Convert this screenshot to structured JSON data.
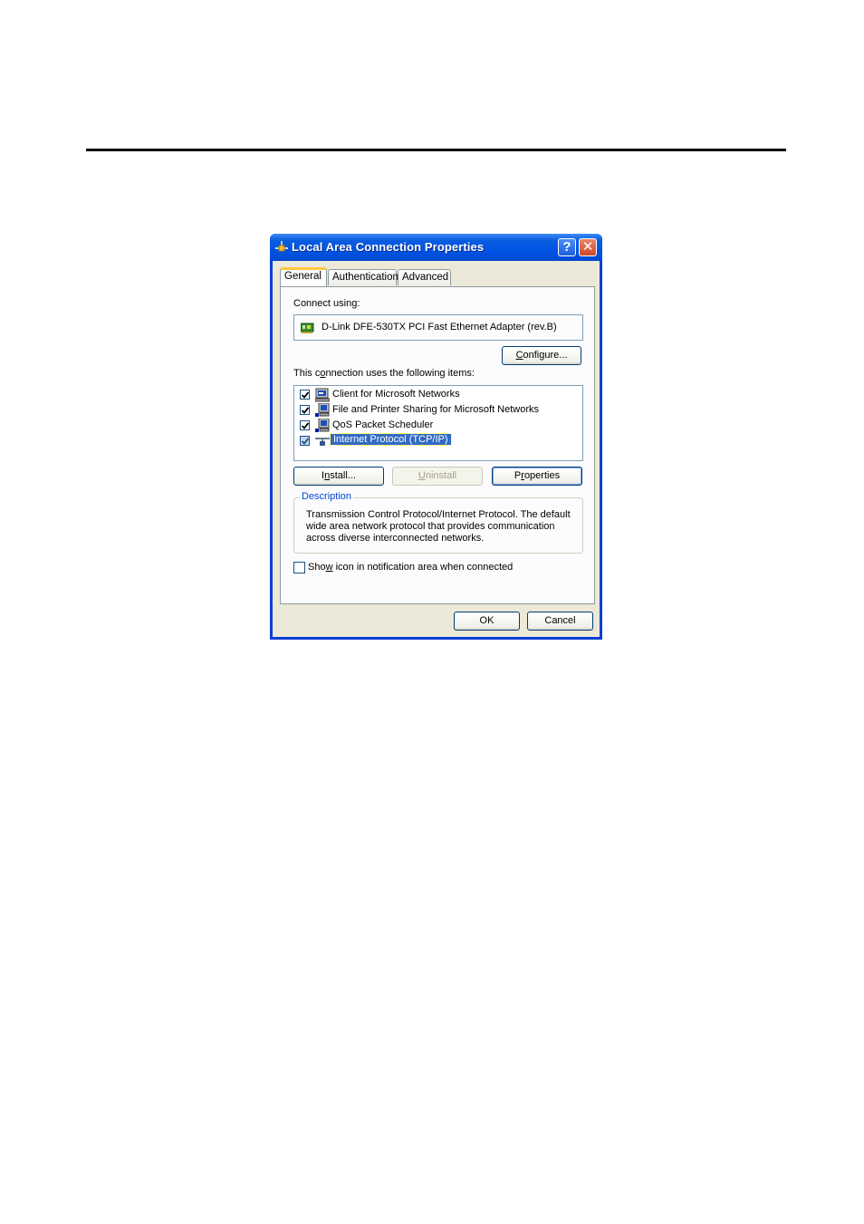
{
  "dialog": {
    "title": "Local Area Connection Properties",
    "help_button": "?",
    "close_button": "✕",
    "tabs": [
      {
        "label": "General",
        "active": true
      },
      {
        "label": "Authentication",
        "active": false
      },
      {
        "label": "Advanced",
        "active": false
      }
    ],
    "connect_using_label": "Connect using:",
    "adapter_name": "D-Link DFE-530TX PCI Fast Ethernet Adapter (rev.B)",
    "configure_button": {
      "pre": "",
      "mnemonic": "C",
      "post": "onfigure..."
    },
    "items_label": {
      "pre": "This c",
      "mnemonic": "o",
      "post": "nnection uses the following items:"
    },
    "items": [
      {
        "label": "Client for Microsoft Networks",
        "checked": true,
        "selected": false,
        "icon": "network-client-icon"
      },
      {
        "label": "File and Printer Sharing for Microsoft Networks",
        "checked": true,
        "selected": false,
        "icon": "network-service-icon"
      },
      {
        "label": "QoS Packet Scheduler",
        "checked": true,
        "selected": false,
        "icon": "network-service-icon"
      },
      {
        "label": "Internet Protocol (TCP/IP)",
        "checked": true,
        "selected": true,
        "icon": "network-protocol-icon"
      }
    ],
    "install_button": {
      "pre": "I",
      "mnemonic": "n",
      "post": "stall..."
    },
    "uninstall_button": {
      "pre": "",
      "mnemonic": "U",
      "post": "ninstall",
      "enabled": false
    },
    "properties_button": {
      "pre": "P",
      "mnemonic": "r",
      "post": "operties"
    },
    "description_title": "Description",
    "description_text": "Transmission Control Protocol/Internet Protocol. The default wide area network protocol that provides communication across diverse interconnected networks.",
    "show_icon_checkbox": {
      "pre": "Sho",
      "mnemonic": "w",
      "post": " icon in notification area when connected",
      "checked": false
    },
    "ok_button": "OK",
    "cancel_button": "Cancel"
  },
  "colors": {
    "titlebar": "#0054e3",
    "dialog_face": "#ece9d8",
    "selection": "#316ac5",
    "active_tab_accent": "#ffc83c",
    "group_title": "#0046d5"
  }
}
